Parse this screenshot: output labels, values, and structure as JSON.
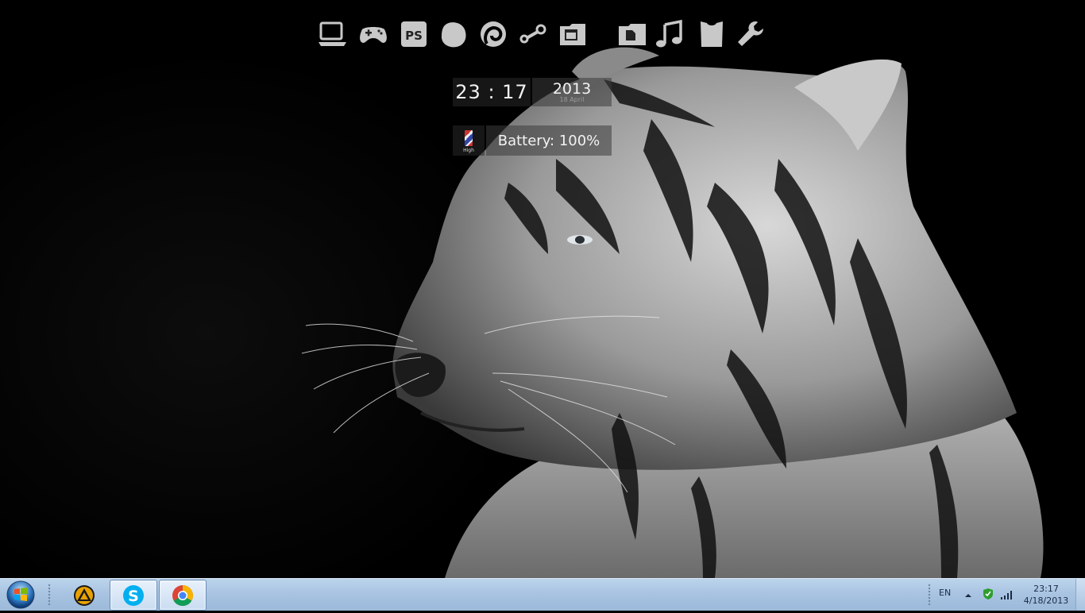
{
  "dock": {
    "icons": [
      "laptop-icon",
      "gamepad-icon",
      "photoshop-icon",
      "chat-bubble-icon",
      "steam-like-icon",
      "steam-icon",
      "window-icon",
      "folder-icon",
      "music-note-icon",
      "shirt-icon",
      "wrench-icon"
    ],
    "photoshop_label": "PS"
  },
  "clock": {
    "time": "23 : 17"
  },
  "date": {
    "year": "2013",
    "day": "18 April"
  },
  "battery": {
    "level_label": "High",
    "text": "Battery: 100%"
  },
  "taskbar": {
    "pinned": [
      "app-icon-triangle",
      "skype-icon",
      "chrome-icon"
    ],
    "tray": {
      "language": "EN",
      "time": "23:17",
      "date": "4/18/2013"
    }
  },
  "colors": {
    "taskbar": "#a9c4e2",
    "desktop": "#000000",
    "widget_text": "#f2f2f2"
  }
}
